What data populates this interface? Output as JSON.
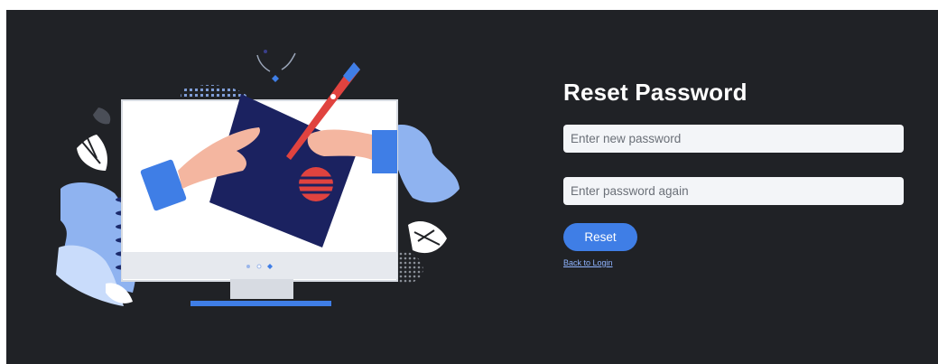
{
  "form": {
    "title": "Reset Password",
    "new_password_placeholder": "Enter new password",
    "confirm_password_placeholder": "Enter password again",
    "reset_label": "Reset",
    "back_link_label": "Back to Login"
  },
  "illustration": {
    "icon": "monitor-signing-document-illustration"
  },
  "colors": {
    "background": "#202226",
    "accent": "#3f7ee6",
    "input_bg": "#f3f5f8",
    "title": "#ffffff",
    "link": "#8fb4ff"
  }
}
